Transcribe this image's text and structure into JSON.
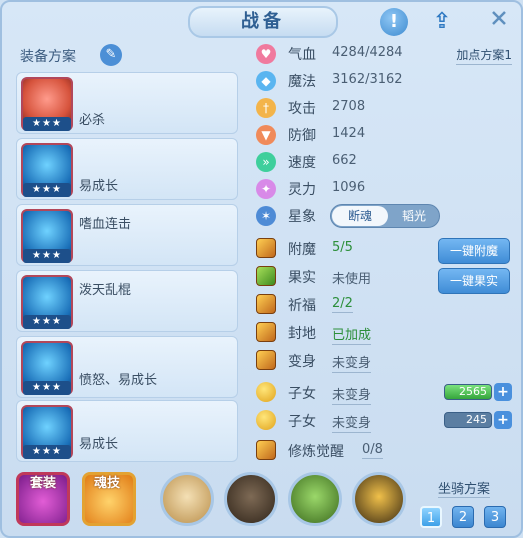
{
  "title": "战备",
  "left": {
    "title": "装备方案",
    "plans": [
      {
        "label": "必杀",
        "stars": "★★★"
      },
      {
        "label": "易成长",
        "stars": "★★★"
      },
      {
        "label": "嗜血连击",
        "stars": "★★★"
      },
      {
        "label": "泼天乱棍",
        "stars": "★★★"
      },
      {
        "label": "愤怒、易成长",
        "stars": "★★★"
      },
      {
        "label": "易成长",
        "stars": "★★★"
      }
    ]
  },
  "stats": {
    "add_plan": "加点方案1",
    "items": [
      {
        "name": "气血",
        "value": "4284/4284",
        "icon": "heart-icon",
        "color": "#f07a9e"
      },
      {
        "name": "魔法",
        "value": "3162/3162",
        "icon": "diamond-icon",
        "color": "#5ab5f0"
      },
      {
        "name": "攻击",
        "value": "2708",
        "icon": "sword-icon",
        "color": "#f3b44a"
      },
      {
        "name": "防御",
        "value": "1424",
        "icon": "shield-icon",
        "color": "#f08a5a"
      },
      {
        "name": "速度",
        "value": "662",
        "icon": "speed-icon",
        "color": "#3ecf9c"
      },
      {
        "name": "灵力",
        "value": "1096",
        "icon": "spirit-icon",
        "color": "#d88ae8"
      }
    ]
  },
  "xiang": {
    "name": "星象",
    "toggle_on": "断魂",
    "toggle_off": "韬光"
  },
  "lines": [
    {
      "name": "附魔",
      "value": "5/5",
      "value_green": true,
      "icon": "enchant-icon"
    },
    {
      "name": "果实",
      "value": "未使用",
      "icon": "fruit-icon"
    },
    {
      "name": "祈福",
      "value": "2/2",
      "value_green": true,
      "icon": "bless-icon"
    },
    {
      "name": "封地",
      "value": "已加成",
      "value_green": true,
      "icon": "fief-icon"
    },
    {
      "name": "变身",
      "value": "未变身",
      "icon": "transform-icon"
    },
    {
      "name": "子女",
      "value": "未变身",
      "icon": "child-icon",
      "bar": "2565",
      "bar_green": true
    },
    {
      "name": "子女",
      "value": "未变身",
      "icon": "child-icon",
      "bar": "245",
      "bar_green": false
    },
    {
      "name": "修炼觉醒",
      "value": "0/8",
      "icon": "awaken-icon"
    }
  ],
  "buttons": {
    "enchant": "一键附魔",
    "fruit": "一键果实"
  },
  "bottom": {
    "suit": "套装",
    "soul": "魂技",
    "mount_title": "坐骑方案",
    "mounts": [
      "1",
      "2",
      "3"
    ]
  }
}
